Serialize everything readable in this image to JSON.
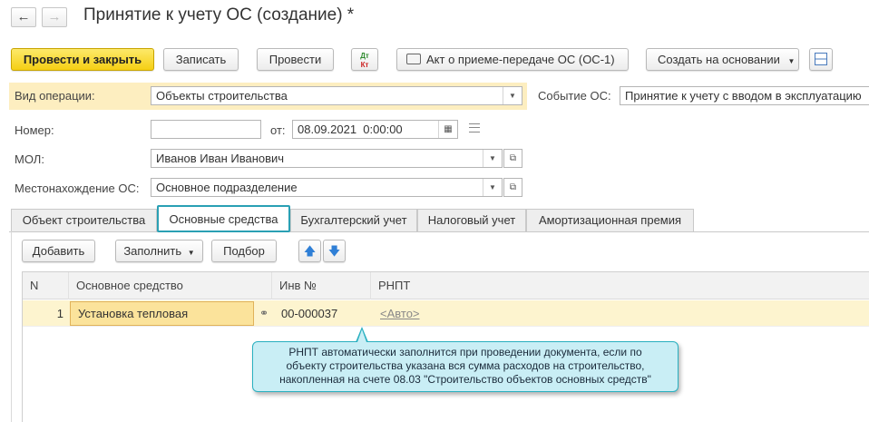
{
  "window": {
    "title": "Принятие к учету ОС (создание) *"
  },
  "toolbar": {
    "post_close": "Провести и закрыть",
    "save": "Записать",
    "post": "Провести",
    "dtkt_dt": "Дт",
    "dtkt_kt": "Кт",
    "print_act": "Акт о приеме-передаче ОС (ОС-1)",
    "create_based": "Создать на основании"
  },
  "form": {
    "operation_label": "Вид операции:",
    "operation_value": "Объекты строительства",
    "event_label": "Событие ОС:",
    "event_value": "Принятие к учету с вводом в эксплуатацию",
    "number_label": "Номер:",
    "number_value": "",
    "date_label": "от:",
    "date_value": "08.09.2021  0:00:00",
    "mol_label": "МОЛ:",
    "mol_value": "Иванов Иван Иванович",
    "location_label": "Местонахождение ОС:",
    "location_value": "Основное подразделение"
  },
  "tabs": [
    {
      "label": "Объект строительства"
    },
    {
      "label": "Основные средства"
    },
    {
      "label": "Бухгалтерский учет"
    },
    {
      "label": "Налоговый учет"
    },
    {
      "label": "Амортизационная премия"
    }
  ],
  "table_toolbar": {
    "add": "Добавить",
    "fill": "Заполнить",
    "pick": "Подбор"
  },
  "table": {
    "columns": [
      "N",
      "Основное средство",
      "Инв №",
      "РНПТ"
    ],
    "rows": [
      {
        "n": "1",
        "asset": "Установка тепловая",
        "inv": "00-000037",
        "rnpt": "<Авто>"
      }
    ]
  },
  "tooltip": {
    "line1": "РНПТ автоматически заполнится при проведении документа, если по",
    "line2": "объекту строительства указана вся сумма расходов на строительство,",
    "line3": "накопленная на счете 08.03 \"Строительство объектов основных средств\""
  },
  "colors": {
    "primary_button": "#f5cf14",
    "highlight_row": "#fdf4cf",
    "active_tab_border": "#2aa0b4",
    "tooltip_border": "#29b0c0"
  }
}
